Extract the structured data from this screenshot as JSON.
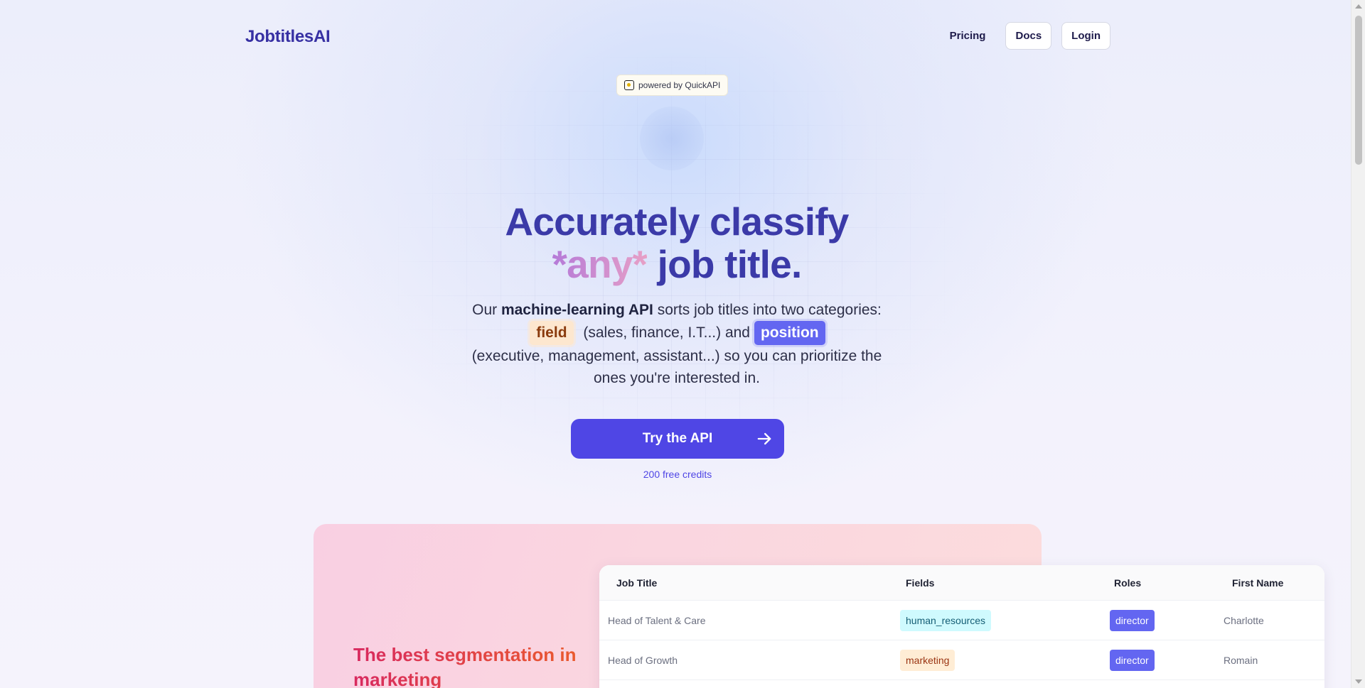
{
  "header": {
    "logo": "JobtitlesAI",
    "nav": {
      "pricing": "Pricing",
      "docs": "Docs",
      "login": "Login"
    }
  },
  "badge": {
    "label": "powered by QuickAPI",
    "icon": "quickapi-logo-icon"
  },
  "hero": {
    "title_line1": "Accurately classify",
    "title_any": "*any*",
    "title_rest": " job title.",
    "desc_prefix": "Our ",
    "desc_bold": "machine-learning API",
    "desc_mid1": " sorts job titles into two categories:",
    "tag_field": "field",
    "desc_mid2": " (sales, finance, I.T...) and",
    "tag_position": "position",
    "desc_end": "(executive, management, assistant...) so you can prioritize the ones you're interested in."
  },
  "cta": {
    "label": "Try the API",
    "icon": "arrow-right-icon",
    "subtext": "200 free credits"
  },
  "demo": {
    "heading": "The best segmentation in marketing",
    "table": {
      "headers": [
        "Job Title",
        "Fields",
        "Roles",
        "First Name"
      ],
      "rows": [
        {
          "job_title": "Head of Talent & Care",
          "field": "human_resources",
          "role": "director",
          "first_name": "Charlotte"
        },
        {
          "job_title": "Head of Growth",
          "field": "marketing",
          "role": "director",
          "first_name": "Romain"
        }
      ]
    }
  },
  "colors": {
    "brand": "#3730a3",
    "accent": "#4f46e5",
    "position_tag": "#6366f1",
    "field_tag_bg": "#fde7cf"
  }
}
